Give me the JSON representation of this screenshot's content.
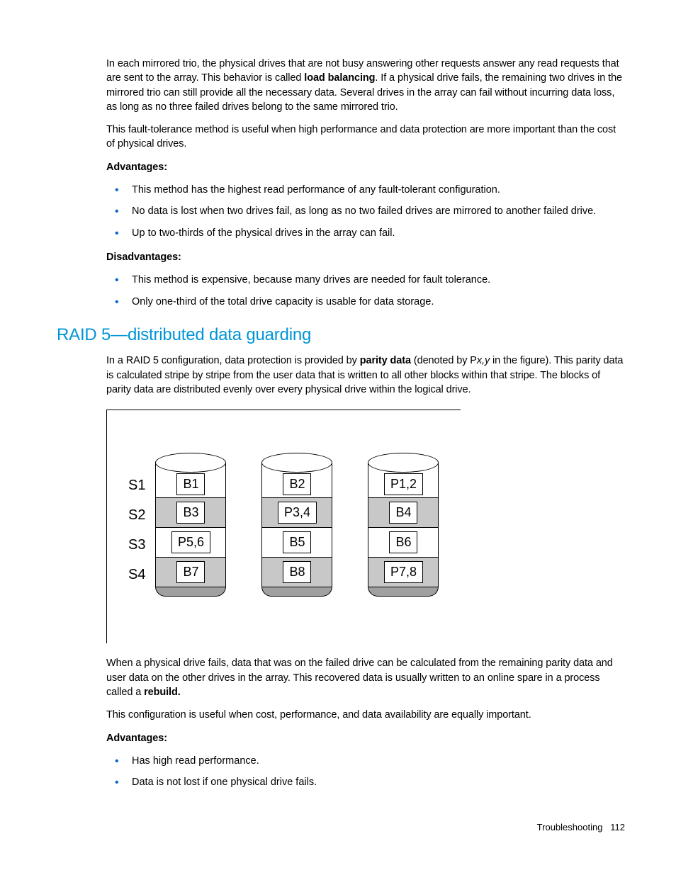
{
  "para1_a": "In each mirrored trio, the physical drives that are not busy answering other requests answer any read requests that are sent to the array. This behavior is called ",
  "para1_b": "load balancing",
  "para1_c": ". If a physical drive fails, the remaining two drives in the mirrored trio can still provide all the necessary data. Several drives in the array can fail without incurring data loss, as long as no three failed drives belong to the same mirrored trio.",
  "para2": "This fault-tolerance method is useful when high performance and data protection are more important than the cost of physical drives.",
  "adv_heading": "Advantages:",
  "adv1_items": [
    "This method has the highest read performance of any fault-tolerant configuration.",
    "No data is lost when two drives fail, as long as no two failed drives are mirrored to another failed drive.",
    "Up to two-thirds of the physical drives in the array can fail."
  ],
  "disadv_heading": "Disadvantages:",
  "disadv_items": [
    "This method is expensive, because many drives are needed for fault tolerance.",
    "Only one-third of the total drive capacity is usable for data storage."
  ],
  "section_heading": "RAID 5—distributed data guarding",
  "raid5_a": "In a RAID 5 configuration, data protection is provided by ",
  "raid5_b": "parity data",
  "raid5_c": " (denoted by P",
  "raid5_d": "x,y",
  "raid5_e": " in the figure). This parity data is calculated stripe by stripe from the user data that is written to all other blocks within that stripe. The blocks of parity data are distributed evenly over every physical drive within the logical drive.",
  "stripes": [
    "S1",
    "S2",
    "S3",
    "S4"
  ],
  "drive1": [
    "B1",
    "B3",
    "P5,6",
    "B7"
  ],
  "drive2": [
    "B2",
    "P3,4",
    "B5",
    "B8"
  ],
  "drive3": [
    "P1,2",
    "B4",
    "B6",
    "P7,8"
  ],
  "after1_a": "When a physical drive fails, data that was on the failed drive can be calculated from the remaining parity data and user data on the other drives in the array. This recovered data is usually written to an online spare in a process called a ",
  "after1_b": "rebuild.",
  "after2": "This configuration is useful when cost, performance, and data availability are equally important.",
  "adv2_heading": "Advantages:",
  "adv2_items": [
    "Has high read performance.",
    "Data is not lost if one physical drive fails."
  ],
  "footer_label": "Troubleshooting",
  "footer_page": "112"
}
